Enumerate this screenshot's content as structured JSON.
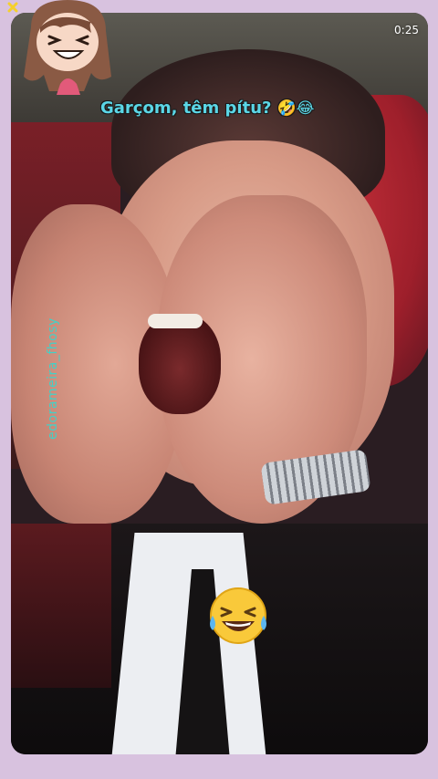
{
  "video": {
    "timestamp": "0:25",
    "caption": "Garçom, têm pítu?",
    "caption_emojis": "🤣😂",
    "watermark": "edorameira_fhosy"
  },
  "overlay": {
    "sticker_icon": "anime-girl-laughing-sticker",
    "reaction_icon": "tears-of-joy-emoji"
  },
  "colors": {
    "page_background": "#d8c2df",
    "caption_text": "#5bd6e6",
    "watermark_text": "#43d1c7",
    "timer_text": "#ffffff"
  }
}
